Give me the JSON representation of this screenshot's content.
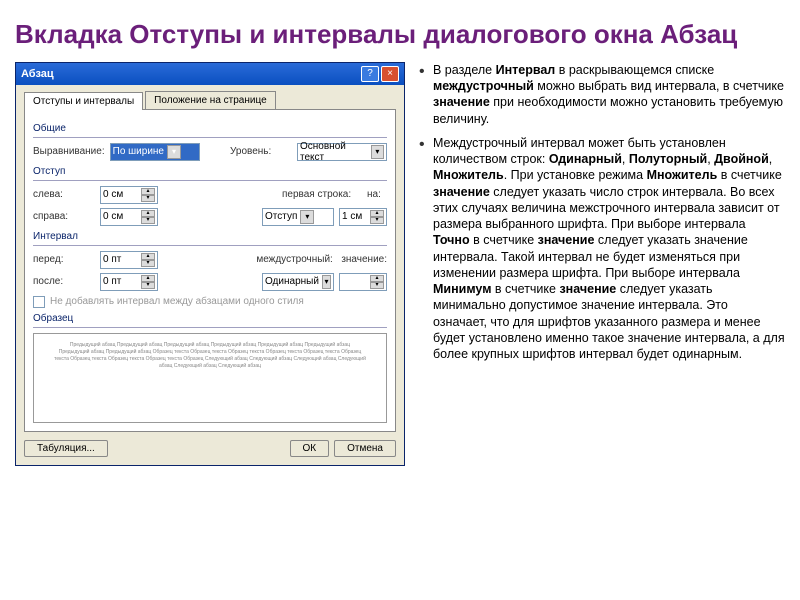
{
  "slide": {
    "title": "Вкладка Отступы и интервалы диалогового окна Абзац",
    "bullets": [
      "В разделе <b>Интервал</b> в раскрывающемся списке <b>междустрочный</b> можно выбрать вид интервала, в счетчике <b>значение</b> при необходимости можно установить требуемую величину.",
      "Междустрочный интервал может быть установлен количеством строк: <b>Одинарный</b>, <b>Полуторный</b>, <b>Двойной</b>, <b>Множитель</b>. При установке режима <b>Множитель</b> в счетчике <b>значение</b> следует указать число строк интервала. Во всех этих случаях величина межстрочного интервала зависит от размера выбранного шрифта. При выборе интервала <b>Точно</b> в счетчике <b>значение</b> следует указать значение интервала. Такой интервал не будет изменяться при изменении размера шрифта. При выборе интервала <b>Минимум</b> в счетчике <b>значение</b> следует указать минимально допустимое значение интервала. Это означает, что для шрифтов указанного размера и менее будет установлено именно такое значение интервала, а для более крупных шрифтов интервал будет одинарным."
    ]
  },
  "dialog": {
    "title": "Абзац",
    "tab1": "Отступы и интервалы",
    "tab2": "Положение на странице",
    "section_general": "Общие",
    "alignment_label": "Выравнивание:",
    "alignment_value": "По ширине",
    "level_label": "Уровень:",
    "level_value": "Основной текст",
    "section_indent": "Отступ",
    "left_label": "слева:",
    "left_value": "0 см",
    "right_label": "справа:",
    "right_value": "0 см",
    "firstline_label": "первая строка:",
    "firstline_value": "Отступ",
    "on_label": "на:",
    "on_value": "1 см",
    "section_interval": "Интервал",
    "before_label": "перед:",
    "before_value": "0 пт",
    "after_label": "после:",
    "after_value": "0 пт",
    "interline_label": "междустрочный:",
    "interline_value": "Одинарный",
    "val_label": "значение:",
    "val_value": "",
    "checkbox": "Не добавлять интервал между абзацами одного стиля",
    "section_sample": "Образец",
    "preview": "Предыдущий абзац Предыдущий абзац Предыдущий абзац Предыдущий абзац Предыдущий абзац Предыдущий абзац Предыдущий абзац Предыдущий абзац\nОбразец текста Образец текста Образец текста Образец текста Образец текста Образец текста Образец текста Образец текста Образец текста Образец\nСледующий абзац Следующий абзац Следующий абзац Следующий абзац Следующий абзац Следующий абзац",
    "btn_tabs": "Табуляция...",
    "btn_ok": "ОК",
    "btn_cancel": "Отмена"
  }
}
